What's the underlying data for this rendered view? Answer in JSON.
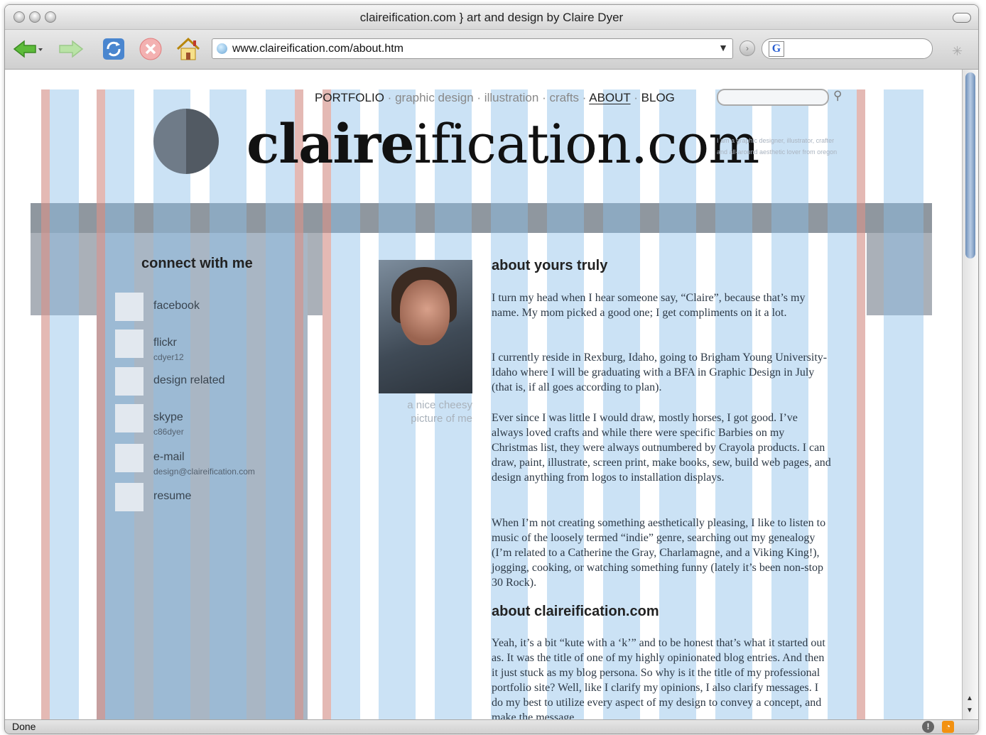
{
  "window": {
    "title": "claireification.com } art and design by Claire Dyer"
  },
  "toolbar": {
    "url": "www.claireification.com/about.htm",
    "search_engine_icon": "G"
  },
  "status": {
    "text": "Done"
  },
  "nav": {
    "portfolio": "PORTFOLIO",
    "sep": "·",
    "graphic_design": "graphic design",
    "illustration": "illustration",
    "crafts": "crafts",
    "about": "ABOUT",
    "blog": "BLOG"
  },
  "logo": {
    "bold": "claire",
    "rest": "ification.com"
  },
  "tagline": {
    "line1": "I am a graphic designer, illustrator, crafter",
    "line2": "and all-around aesthetic lover from oregon"
  },
  "sidebar": {
    "title": "connect with me",
    "items": [
      {
        "label": "facebook",
        "sub": ""
      },
      {
        "label": "flickr",
        "sub": "cdyer12"
      },
      {
        "label": "design related",
        "sub": ""
      },
      {
        "label": "skype",
        "sub": "c86dyer"
      },
      {
        "label": "e-mail",
        "sub": "design@claireification.com"
      },
      {
        "label": "resume",
        "sub": ""
      }
    ]
  },
  "photo": {
    "caption_1": "a nice cheesy",
    "caption_2": "picture of me"
  },
  "main": {
    "heading_about": "about yours truly",
    "paragraphs": [
      "I turn my head when I hear someone say, “Claire”, because that’s my name. My mom picked a good one; I get compliments on it a lot.",
      "I currently reside in Rexburg, Idaho, going to Brigham Young University-Idaho where I will be graduating with a BFA in Graphic Design in July (that is, if all goes according to plan).",
      "Ever since I was little I would draw, mostly horses, I got good. I’ve always loved crafts and while there were specific Barbies on my Christmas list, they were always outnumbered by Crayola products. I can draw, paint, illustrate, screen print, make books, sew, build web pages, and design anything from logos to installation displays.",
      "When I’m not creating something aesthetically pleasing, I like to listen to music of the loosely termed “indie” genre, searching out my genealogy (I’m related to a Catherine the Gray, Charlamagne, and a Viking King!), jogging, cooking, or watching something funny (lately it’s been non-stop 30 Rock)."
    ],
    "heading_site": "about claireification.com",
    "paragraph_site": "Yeah, it’s a bit “kute with a ‘k’” and to be honest that’s what it started out as. It was the title of one of my highly opinionated blog entries. And then it just stuck as my blog persona. So why is it the title of my professional portfolio site? Well, like I clarify my opinions, I also clarify messages. I do my best to utilize every aspect of my design to convey a concept, and make the message"
  }
}
